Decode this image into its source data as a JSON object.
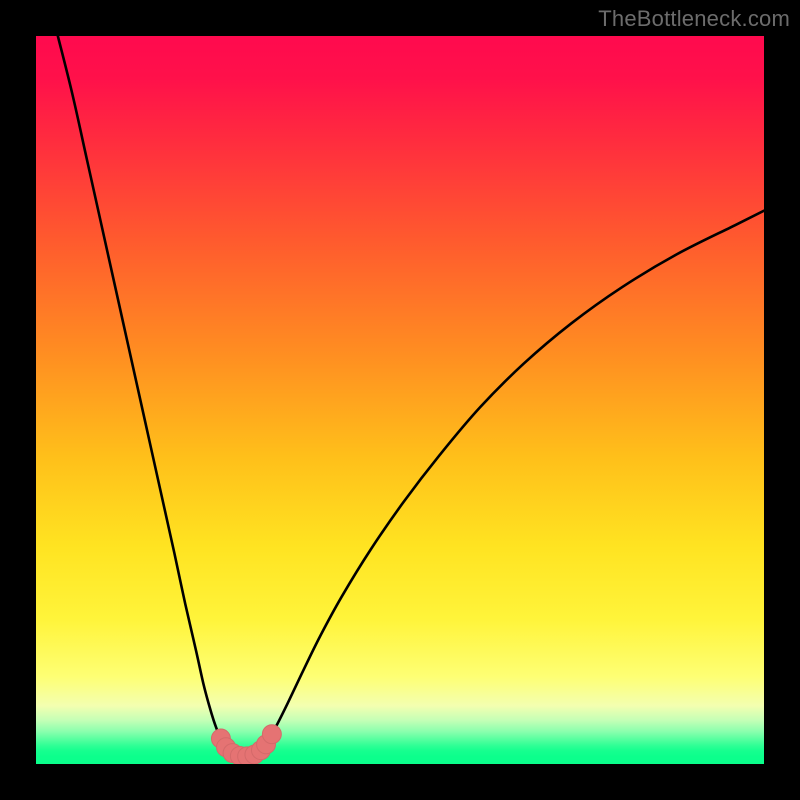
{
  "watermark": {
    "text": "TheBottleneck.com"
  },
  "colors": {
    "frame": "#000000",
    "curve": "#000000",
    "marker_fill": "#e57373",
    "marker_stroke": "#d46a6a",
    "gradient_stops": [
      "#ff0a4e",
      "#ff114a",
      "#ff2b3f",
      "#ff5a2e",
      "#ff8f21",
      "#ffc01a",
      "#ffe321",
      "#fff43a",
      "#feff74",
      "#f3ffb0",
      "#c4ffb6",
      "#8cffae",
      "#5cffa1",
      "#2eff95",
      "#16ff8f",
      "#0cff8c",
      "#0aff8b"
    ]
  },
  "chart_data": {
    "type": "line",
    "title": "",
    "xlabel": "",
    "ylabel": "",
    "xlim": [
      0,
      100
    ],
    "ylim": [
      0,
      100
    ],
    "grid": false,
    "legend": false,
    "series": [
      {
        "name": "left-branch",
        "x": [
          3,
          5,
          7,
          9,
          11,
          13,
          15,
          17,
          19,
          20.5,
          22,
          23,
          23.8,
          24.4,
          24.9,
          25.3,
          25.7,
          26.0,
          26.3,
          26.6
        ],
        "y": [
          100,
          92,
          83,
          74,
          65,
          56,
          47,
          38,
          29,
          22,
          15.5,
          11,
          8,
          6,
          4.6,
          3.6,
          2.9,
          2.4,
          2.0,
          1.7
        ]
      },
      {
        "name": "valley-floor",
        "x": [
          26.6,
          27.2,
          27.9,
          28.6,
          29.3,
          30.0,
          30.6,
          31.2
        ],
        "y": [
          1.7,
          1.3,
          1.1,
          1.05,
          1.1,
          1.3,
          1.7,
          2.2
        ]
      },
      {
        "name": "right-branch",
        "x": [
          31.2,
          32.0,
          33.0,
          34.5,
          36.5,
          39.0,
          42.0,
          46.0,
          50.5,
          55.5,
          61.0,
          67.0,
          73.5,
          80.5,
          88.0,
          96.0,
          100.0
        ],
        "y": [
          2.2,
          3.4,
          5.2,
          8.2,
          12.4,
          17.5,
          23.0,
          29.5,
          36.0,
          42.5,
          49.0,
          55.0,
          60.5,
          65.5,
          70.0,
          74.0,
          76.0
        ]
      }
    ],
    "markers": {
      "name": "valley-markers",
      "points": [
        {
          "x": 25.4,
          "y": 3.5
        },
        {
          "x": 26.1,
          "y": 2.3
        },
        {
          "x": 27.0,
          "y": 1.5
        },
        {
          "x": 28.0,
          "y": 1.1
        },
        {
          "x": 29.0,
          "y": 1.05
        },
        {
          "x": 30.0,
          "y": 1.3
        },
        {
          "x": 30.9,
          "y": 1.9
        },
        {
          "x": 31.6,
          "y": 2.7
        },
        {
          "x": 32.4,
          "y": 4.1
        }
      ],
      "radius": 1.3
    }
  }
}
